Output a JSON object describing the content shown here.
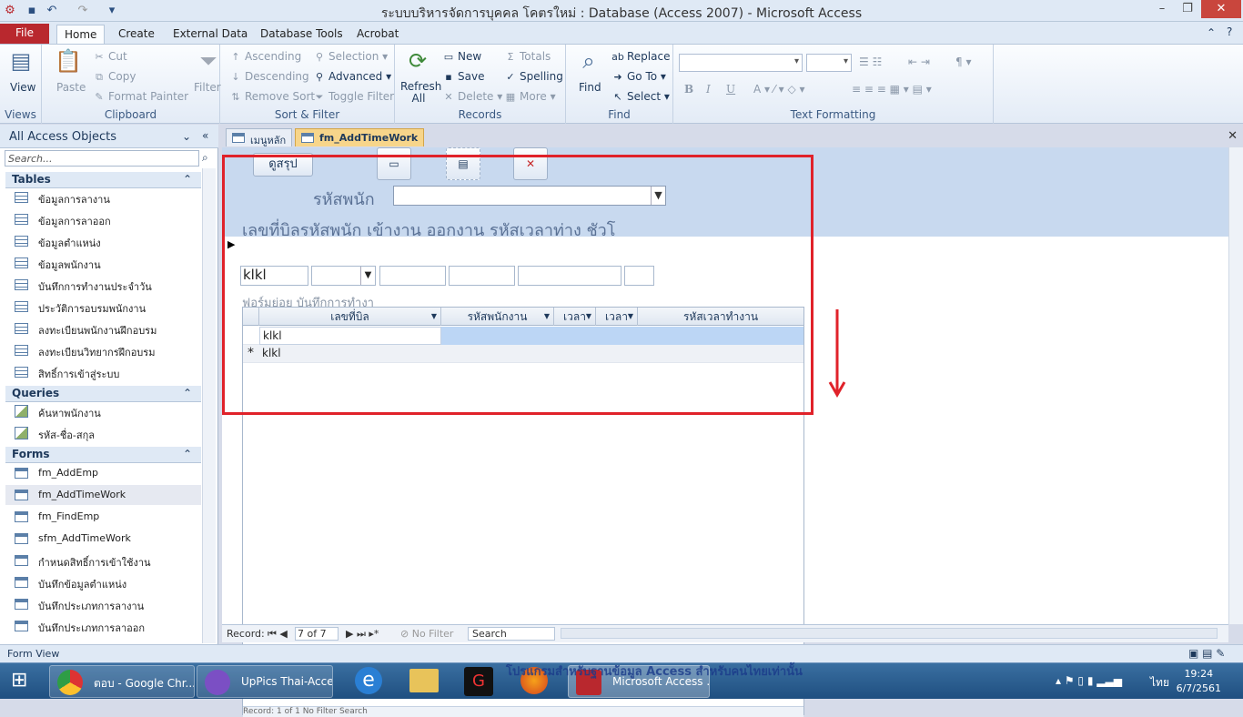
{
  "window": {
    "title": "ระบบบริหารจัดการบุคคล โคตรใหม่ : Database (Access 2007) - Microsoft Access",
    "qat_icons": [
      "access-logo-icon",
      "save-icon",
      "undo-icon",
      "redo-icon",
      "customize-icon"
    ]
  },
  "ribbon_tabs": [
    "File",
    "Home",
    "Create",
    "External Data",
    "Database Tools",
    "Acrobat"
  ],
  "ribbon": {
    "views": {
      "label": "Views",
      "view": "View"
    },
    "clipboard": {
      "label": "Clipboard",
      "paste": "Paste",
      "cut": "Cut",
      "copy": "Copy",
      "format_painter": "Format Painter"
    },
    "sort_filter": {
      "label": "Sort & Filter",
      "filter": "Filter",
      "ascending": "Ascending",
      "descending": "Descending",
      "remove_sort": "Remove Sort",
      "selection": "Selection",
      "advanced": "Advanced",
      "toggle_filter": "Toggle Filter"
    },
    "records": {
      "label": "Records",
      "refresh": "Refresh All",
      "new": "New",
      "save": "Save",
      "delete": "Delete",
      "totals": "Totals",
      "spelling": "Spelling",
      "more": "More"
    },
    "find": {
      "label": "Find",
      "find": "Find",
      "replace": "Replace",
      "goto": "Go To",
      "select": "Select"
    },
    "text_formatting": {
      "label": "Text Formatting",
      "bold": "B",
      "italic": "I",
      "underline": "U"
    }
  },
  "nav": {
    "title": "All Access Objects",
    "search_placeholder": "Search...",
    "tables_label": "Tables",
    "tables": [
      "ข้อมูลการลางาน",
      "ข้อมูลการลาออก",
      "ข้อมูลตำแหน่ง",
      "ข้อมูลพนักงาน",
      "บันทึกการทำงานประจำวัน",
      "ประวัติการอบรมพนักงาน",
      "ลงทะเบียนพนักงานฝึกอบรม",
      "ลงทะเบียนวิทยากรฝึกอบรม",
      "สิทธิ์การเข้าสู่ระบบ"
    ],
    "queries_label": "Queries",
    "queries": [
      "ค้นหาพนักงาน",
      "รหัส-ชื่อ-สกุล"
    ],
    "forms_label": "Forms",
    "forms": [
      "fm_AddEmp",
      "fm_AddTimeWork",
      "fm_FindEmp",
      "sfm_AddTimeWork",
      "กำหนดสิทธิ์การเข้าใช้งาน",
      "บันทึกข้อมูลตำแหน่ง",
      "บันทึกประเภทการลางาน",
      "บันทึกประเภทการลาออก"
    ]
  },
  "doc_tabs": [
    "เมนูหลัก",
    "fm_AddTimeWork"
  ],
  "form": {
    "summary_button": "ดูสรุป",
    "emp_label": "รหัสพนัก",
    "column_header": "เลขที่บิลรหัสพนัก เข้างาน ออกงาน รหัสเวลาท่าง ชัวโ",
    "field_bill": "klkl",
    "subform_label": "ฟอร์มย่อย บันทึกการทำงา",
    "sub_headers": [
      "เลขที่บิล",
      "รหัสพนักงาน",
      "เวลา",
      "เวลา",
      "รหัสเวลาทำงาน"
    ],
    "sub_rows": [
      [
        "klkl",
        "",
        "",
        "",
        ""
      ],
      [
        "klkl",
        "",
        "",
        "",
        ""
      ]
    ],
    "sub_recnav": "Record: 1 of 1  No Filter  Search"
  },
  "recnav": {
    "label": "Record:",
    "position": "7 of 7",
    "filter": "No Filter",
    "search": "Search"
  },
  "status": "Form View",
  "taskbar": {
    "items": [
      "ตอบ - Google Chr...",
      "UpPics Thai-Acce...",
      "Microsoft Access ..."
    ],
    "background_text": "โปรแกรมสำหรับฐานข้อมูล Access สำหรับคนไทยเท่านั้น",
    "lang": "ไทย",
    "time": "19:24",
    "date": "6/7/2561"
  },
  "colors": {
    "accent_red": "#e0222a",
    "file_tab": "#b9282e",
    "active_tab": "#f7d58a"
  }
}
